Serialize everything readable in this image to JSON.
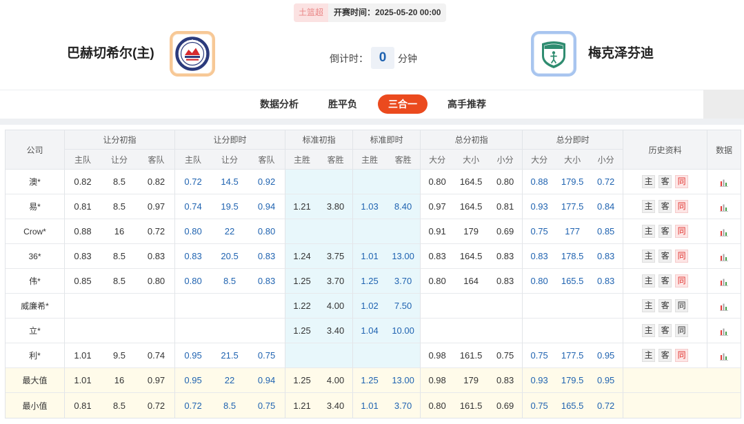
{
  "match": {
    "league": "土篮超",
    "start_label": "开赛时间：",
    "start_time": "2025-05-20 00:00",
    "home_name": "巴赫切希尔(主)",
    "away_name": "梅克泽芬迪",
    "countdown_label": "倒计时：",
    "countdown_value": "0",
    "countdown_unit": "分钟"
  },
  "tabs": [
    {
      "label": "数据分析",
      "active": false
    },
    {
      "label": "胜平负",
      "active": false
    },
    {
      "label": "三合一",
      "active": true
    },
    {
      "label": "高手推荐",
      "active": false
    }
  ],
  "table": {
    "headers": {
      "company": "公司",
      "groups": [
        {
          "label": "让分初指",
          "subs": [
            "主队",
            "让分",
            "客队"
          ]
        },
        {
          "label": "让分即时",
          "subs": [
            "主队",
            "让分",
            "客队"
          ]
        },
        {
          "label": "标准初指",
          "subs": [
            "主胜",
            "客胜"
          ]
        },
        {
          "label": "标准即时",
          "subs": [
            "主胜",
            "客胜"
          ]
        },
        {
          "label": "总分初指",
          "subs": [
            "大分",
            "大小",
            "小分"
          ]
        },
        {
          "label": "总分即时",
          "subs": [
            "大分",
            "大小",
            "小分"
          ]
        }
      ],
      "history": "历史资料",
      "data": "数据"
    },
    "history_buttons": [
      "主",
      "客",
      "同"
    ],
    "rows": [
      {
        "company": "澳*",
        "same_active": true,
        "values": [
          "0.82",
          "8.5",
          "0.82",
          "0.72",
          "14.5",
          "0.92",
          null,
          null,
          null,
          null,
          "0.80",
          "164.5",
          "0.80",
          "0.88",
          "179.5",
          "0.72"
        ]
      },
      {
        "company": "易*",
        "same_active": true,
        "values": [
          "0.81",
          "8.5",
          "0.97",
          "0.74",
          "19.5",
          "0.94",
          "1.21",
          "3.80",
          "1.03",
          "8.40",
          "0.97",
          "164.5",
          "0.81",
          "0.93",
          "177.5",
          "0.84"
        ]
      },
      {
        "company": "Crow*",
        "same_active": true,
        "values": [
          "0.88",
          "16",
          "0.72",
          "0.80",
          "22",
          "0.80",
          null,
          null,
          null,
          null,
          "0.91",
          "179",
          "0.69",
          "0.75",
          "177",
          "0.85"
        ]
      },
      {
        "company": "36*",
        "same_active": true,
        "values": [
          "0.83",
          "8.5",
          "0.83",
          "0.83",
          "20.5",
          "0.83",
          "1.24",
          "3.75",
          "1.01",
          "13.00",
          "0.83",
          "164.5",
          "0.83",
          "0.83",
          "178.5",
          "0.83"
        ]
      },
      {
        "company": "伟*",
        "same_active": true,
        "values": [
          "0.85",
          "8.5",
          "0.80",
          "0.80",
          "8.5",
          "0.83",
          "1.25",
          "3.70",
          "1.25",
          "3.70",
          "0.80",
          "164",
          "0.83",
          "0.80",
          "165.5",
          "0.83"
        ]
      },
      {
        "company": "威廉希*",
        "same_active": false,
        "values": [
          null,
          null,
          null,
          null,
          null,
          null,
          "1.22",
          "4.00",
          "1.02",
          "7.50",
          null,
          null,
          null,
          null,
          null,
          null
        ]
      },
      {
        "company": "立*",
        "same_active": false,
        "values": [
          null,
          null,
          null,
          null,
          null,
          null,
          "1.25",
          "3.40",
          "1.04",
          "10.00",
          null,
          null,
          null,
          null,
          null,
          null
        ]
      },
      {
        "company": "利*",
        "same_active": true,
        "values": [
          "1.01",
          "9.5",
          "0.74",
          "0.95",
          "21.5",
          "0.75",
          null,
          null,
          null,
          null,
          "0.98",
          "161.5",
          "0.75",
          "0.75",
          "177.5",
          "0.95"
        ]
      },
      {
        "company": "最大值",
        "summary": true,
        "values": [
          "1.01",
          "16",
          "0.97",
          "0.95",
          "22",
          "0.94",
          "1.25",
          "4.00",
          "1.25",
          "13.00",
          "0.98",
          "179",
          "0.83",
          "0.93",
          "179.5",
          "0.95"
        ]
      },
      {
        "company": "最小值",
        "summary": true,
        "values": [
          "0.81",
          "8.5",
          "0.72",
          "0.72",
          "8.5",
          "0.75",
          "1.21",
          "3.40",
          "1.01",
          "3.70",
          "0.80",
          "161.5",
          "0.69",
          "0.75",
          "165.5",
          "0.72"
        ]
      }
    ]
  },
  "icons": {
    "data_column": "bar-chart-icon"
  },
  "colors": {
    "accent": "#eb4a1e",
    "live_odds": "#1e62b0",
    "countdown": "#1e62b0",
    "same_active": "#e0322d",
    "league_badge": "#e98585",
    "standard_bg": "#e8f7fb",
    "summary_bg": "#fffbea"
  }
}
